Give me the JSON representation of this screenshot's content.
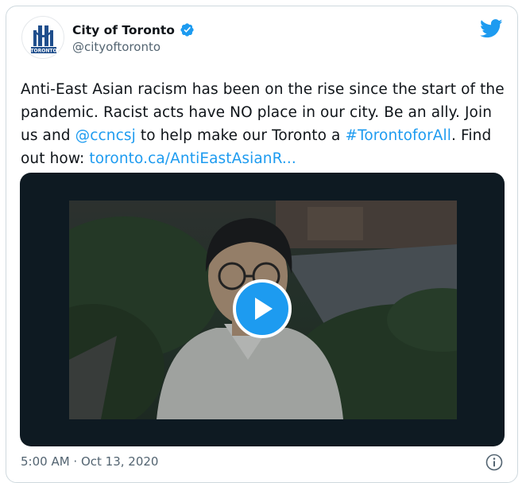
{
  "tweet": {
    "author": {
      "display_name": "City of Toronto",
      "handle": "@cityoftoronto",
      "verified": true,
      "avatar_logo_text": "TORONTO"
    },
    "text": {
      "part1": "Anti-East Asian racism has been on the rise since the start of the pandemic. Racist acts have NO place in our city. Be an ally. Join us and ",
      "mention": "@ccncsj",
      "part2": " to help make our Toronto a ",
      "hashtag": "#TorontoforAll",
      "part3": ". Find out how: ",
      "link": "toronto.ca/AntiEastAsianR..."
    },
    "media": {
      "type": "video",
      "play_icon": "play-icon"
    },
    "timestamp": "5:00 AM · Oct 13, 2020",
    "icons": {
      "platform": "twitter-bird-icon",
      "verified": "verified-badge-icon",
      "info": "info-icon"
    },
    "colors": {
      "accent": "#1d9bf0",
      "text": "#0f1419",
      "secondary": "#536471"
    }
  }
}
